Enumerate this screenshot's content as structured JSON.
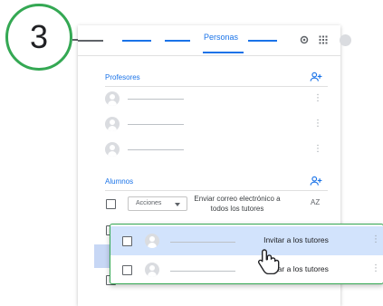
{
  "step": {
    "number": "3"
  },
  "header": {
    "active_tab": "Personas"
  },
  "teachers": {
    "title": "Profesores",
    "count": 3
  },
  "students": {
    "title": "Alumnos",
    "actions_label": "Acciones",
    "email_tutors": "Enviar correo electrónico a todos los tutores",
    "sort_label": "AZ"
  },
  "popup": {
    "rows": [
      {
        "label": "Invitar a los tutores",
        "selected": true
      },
      {
        "label": "Invitar a los tutores",
        "selected": false
      }
    ]
  },
  "colors": {
    "accent": "#1a73e8",
    "highlight": "#34a853",
    "selection": "#d2e3fc"
  },
  "icons": [
    "settings-icon",
    "apps-grid-icon",
    "account-icon",
    "add-person-icon",
    "more-vert-icon",
    "hand-cursor-icon",
    "sort-az-icon",
    "dropdown-caret-icon"
  ]
}
